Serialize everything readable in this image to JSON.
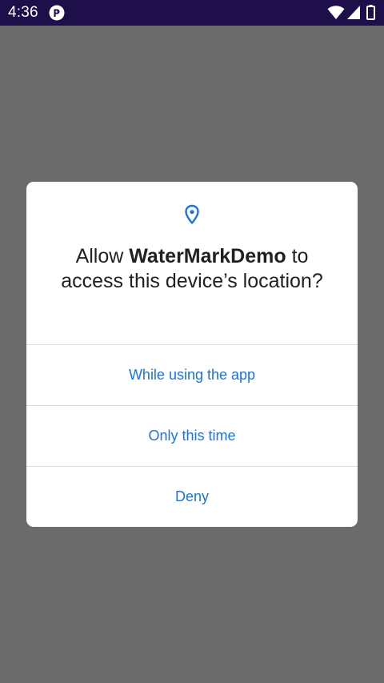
{
  "status_bar": {
    "time": "4:36",
    "background": "#1e0f4a",
    "icons": [
      "app-notification-icon",
      "wifi-icon",
      "cell-signal-icon",
      "battery-icon"
    ]
  },
  "dialog": {
    "icon": "location-pin-icon",
    "accent_color": "#1a73e8",
    "title_prefix": "Allow ",
    "app_name": "WaterMarkDemo",
    "title_suffix": " to access this device’s location?",
    "options": [
      "While using the app",
      "Only this time",
      "Deny"
    ]
  }
}
